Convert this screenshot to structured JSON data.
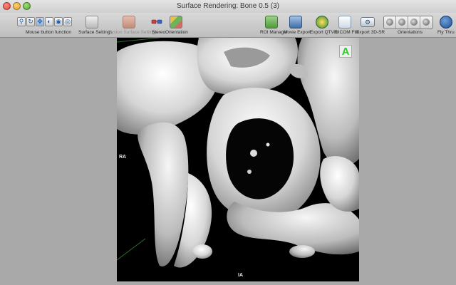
{
  "window": {
    "title": "Surface Rendering: Bone 0.5 (3)"
  },
  "toolbar": {
    "mouse_function_label": "Mouse button function",
    "surface_settings_label": "Surface Settings",
    "fusion_label": "Fusion Surface Settings",
    "stereo_label": "Stereo",
    "orientation_label": "Orientation",
    "roi_label": "ROI Manager",
    "movie_label": "Movie Export",
    "qtvr_label": "Export QTVR",
    "dicom_label": "DICOM File",
    "export3d_label": "Export 3D-SR",
    "orientations_label": "Orientations",
    "fly_label": "Fly Thru"
  },
  "viewport": {
    "left_label": "RA",
    "bottom_label": "IA",
    "badge": "A",
    "badge_color": "#2bcf2b"
  }
}
